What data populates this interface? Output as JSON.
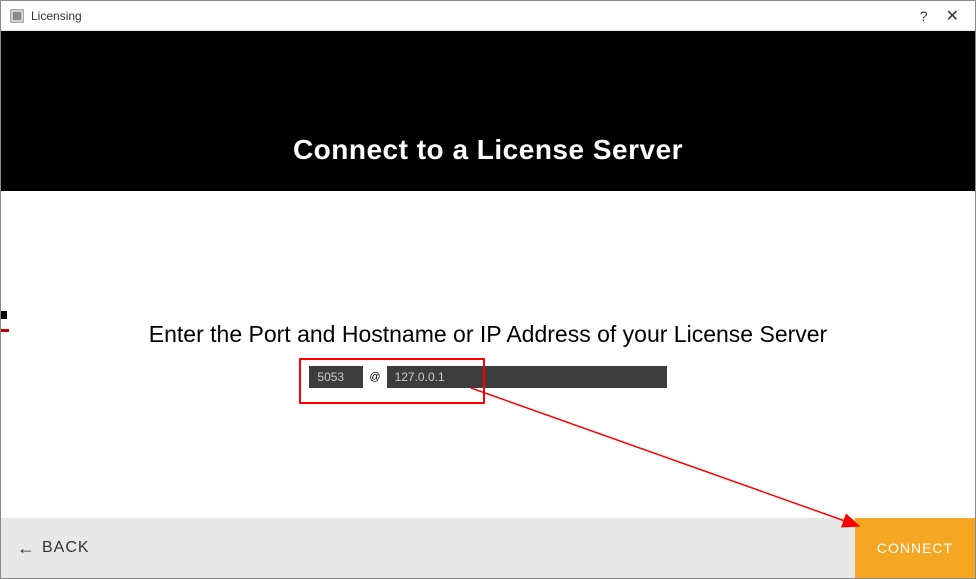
{
  "window": {
    "title": "Licensing"
  },
  "header": {
    "title": "Connect to a License Server"
  },
  "content": {
    "instruction": "Enter the Port and Hostname or IP Address of your License Server",
    "port_value": "5053",
    "at_symbol": "@",
    "host_value": "127.0.0.1"
  },
  "footer": {
    "back_label": "BACK",
    "connect_label": "CONNECT"
  }
}
